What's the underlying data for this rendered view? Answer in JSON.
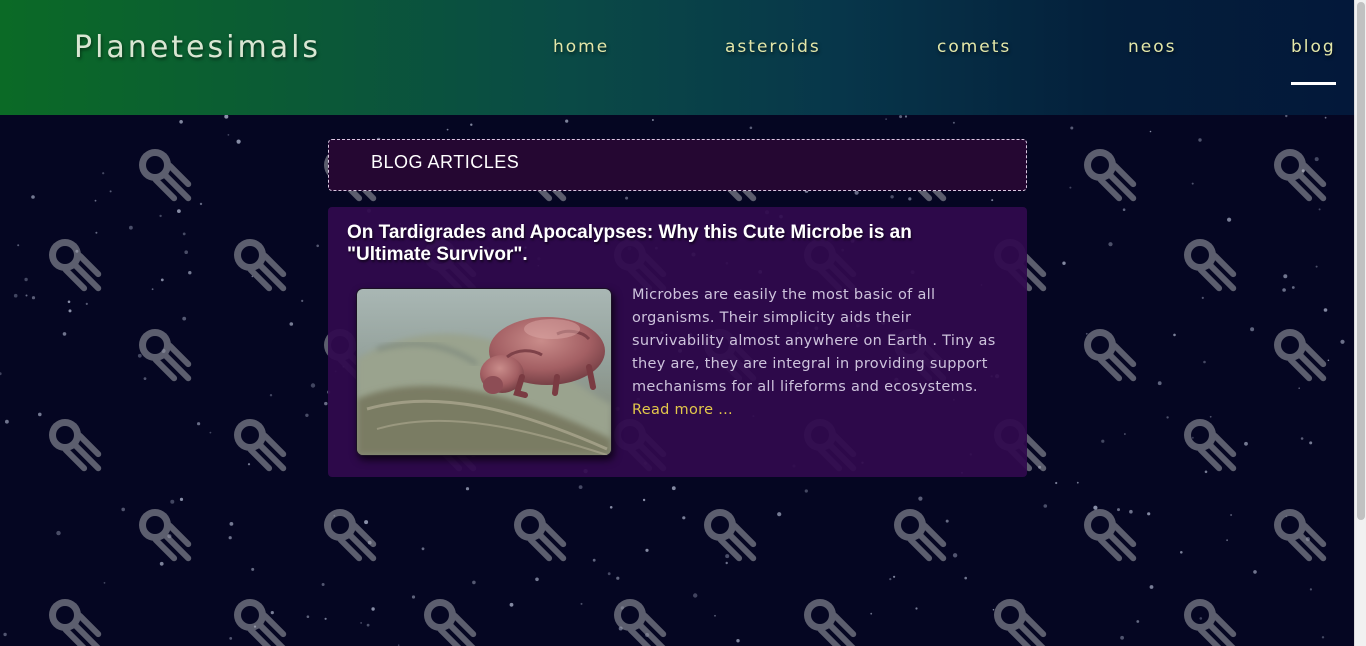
{
  "header": {
    "brand": "Planetesimals",
    "nav": [
      {
        "label": "home",
        "active": false
      },
      {
        "label": "asteroids",
        "active": false
      },
      {
        "label": "comets",
        "active": false
      },
      {
        "label": "neos",
        "active": false
      },
      {
        "label": "blog",
        "active": true
      }
    ]
  },
  "main": {
    "section_title": "BLOG ARTICLES",
    "articles": [
      {
        "title": "On Tardigrades and Apocalypses: Why this Cute Microbe is an \"Ultimate Survivor\".",
        "excerpt": "Microbes are easily the most basic of all organisms. Their simplicity aids their survivability almost anywhere on Earth . Tiny as they are, they are integral in providing support mechanisms for all lifeforms and ecosystems.",
        "read_more": "Read more ...",
        "image_icon": "tardigrade-photo"
      }
    ]
  },
  "colors": {
    "header_gradient_start": "#0b6a26",
    "header_gradient_end": "#03183a",
    "nav_text": "#e3e7a9",
    "page_background": "#050622",
    "card_background": "#300a4e",
    "title_box_background": "#250732",
    "read_more": "#e3c84a"
  }
}
